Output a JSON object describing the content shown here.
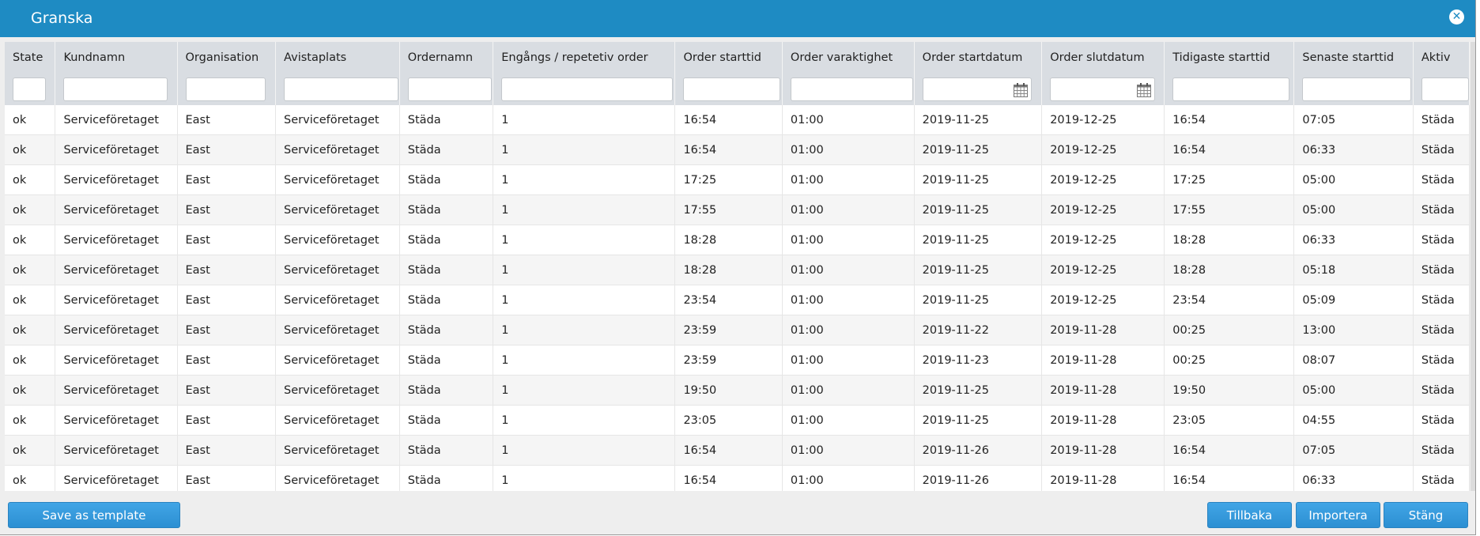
{
  "window": {
    "title": "Granska"
  },
  "columns": [
    "State",
    "Kundnamn",
    "Organisation",
    "Avistaplats",
    "Ordernamn",
    "Engångs / repetetiv order",
    "Order starttid",
    "Order varaktighet",
    "Order startdatum",
    "Order slutdatum",
    "Tidigaste starttid",
    "Senaste starttid",
    "Aktiv"
  ],
  "rows": [
    [
      "ok",
      "Serviceföretaget",
      "East",
      "Serviceföretaget",
      "Städa",
      "1",
      "16:54",
      "01:00",
      "2019-11-25",
      "2019-12-25",
      "16:54",
      "07:05",
      "Städa"
    ],
    [
      "ok",
      "Serviceföretaget",
      "East",
      "Serviceföretaget",
      "Städa",
      "1",
      "16:54",
      "01:00",
      "2019-11-25",
      "2019-12-25",
      "16:54",
      "06:33",
      "Städa"
    ],
    [
      "ok",
      "Serviceföretaget",
      "East",
      "Serviceföretaget",
      "Städa",
      "1",
      "17:25",
      "01:00",
      "2019-11-25",
      "2019-12-25",
      "17:25",
      "05:00",
      "Städa"
    ],
    [
      "ok",
      "Serviceföretaget",
      "East",
      "Serviceföretaget",
      "Städa",
      "1",
      "17:55",
      "01:00",
      "2019-11-25",
      "2019-12-25",
      "17:55",
      "05:00",
      "Städa"
    ],
    [
      "ok",
      "Serviceföretaget",
      "East",
      "Serviceföretaget",
      "Städa",
      "1",
      "18:28",
      "01:00",
      "2019-11-25",
      "2019-12-25",
      "18:28",
      "06:33",
      "Städa"
    ],
    [
      "ok",
      "Serviceföretaget",
      "East",
      "Serviceföretaget",
      "Städa",
      "1",
      "18:28",
      "01:00",
      "2019-11-25",
      "2019-12-25",
      "18:28",
      "05:18",
      "Städa"
    ],
    [
      "ok",
      "Serviceföretaget",
      "East",
      "Serviceföretaget",
      "Städa",
      "1",
      "23:54",
      "01:00",
      "2019-11-25",
      "2019-12-25",
      "23:54",
      "05:09",
      "Städa"
    ],
    [
      "ok",
      "Serviceföretaget",
      "East",
      "Serviceföretaget",
      "Städa",
      "1",
      "23:59",
      "01:00",
      "2019-11-22",
      "2019-11-28",
      "00:25",
      "13:00",
      "Städa"
    ],
    [
      "ok",
      "Serviceföretaget",
      "East",
      "Serviceföretaget",
      "Städa",
      "1",
      "23:59",
      "01:00",
      "2019-11-23",
      "2019-11-28",
      "00:25",
      "08:07",
      "Städa"
    ],
    [
      "ok",
      "Serviceföretaget",
      "East",
      "Serviceföretaget",
      "Städa",
      "1",
      "19:50",
      "01:00",
      "2019-11-25",
      "2019-11-28",
      "19:50",
      "05:00",
      "Städa"
    ],
    [
      "ok",
      "Serviceföretaget",
      "East",
      "Serviceföretaget",
      "Städa",
      "1",
      "23:05",
      "01:00",
      "2019-11-25",
      "2019-11-28",
      "23:05",
      "04:55",
      "Städa"
    ],
    [
      "ok",
      "Serviceföretaget",
      "East",
      "Serviceföretaget",
      "Städa",
      "1",
      "16:54",
      "01:00",
      "2019-11-26",
      "2019-11-28",
      "16:54",
      "07:05",
      "Städa"
    ],
    [
      "ok",
      "Serviceföretaget",
      "East",
      "Serviceföretaget",
      "Städa",
      "1",
      "16:54",
      "01:00",
      "2019-11-26",
      "2019-11-28",
      "16:54",
      "06:33",
      "Städa"
    ]
  ],
  "buttons": {
    "save_template": "Save as template",
    "back": "Tillbaka",
    "import": "Importera",
    "close": "Stäng"
  },
  "icons": {
    "close": "close-circle-icon",
    "date_filter": "calendar-icon"
  },
  "colors": {
    "titlebar": "#1e8bc3",
    "button": "#3399dd",
    "header": "#d9dde2"
  }
}
